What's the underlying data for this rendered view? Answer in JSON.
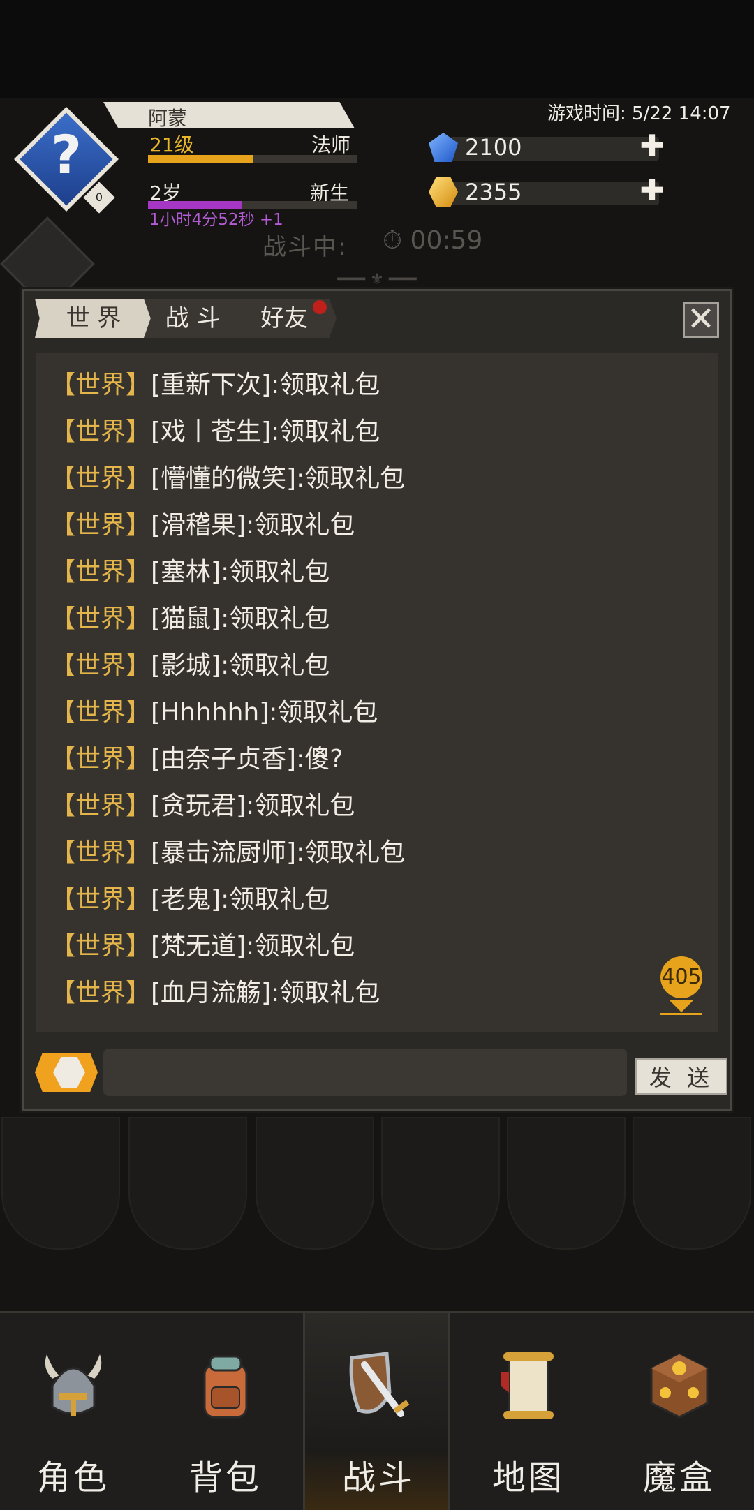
{
  "player": {
    "name": "阿蒙",
    "level": "21级",
    "class": "法师",
    "level_progress": 0.5,
    "age": "2岁",
    "stage": "新生",
    "age_progress": 0.45,
    "timer": "1小时4分52秒 +1",
    "avatar_glyph": "?",
    "avatar_badge": "0"
  },
  "game_time": "游戏时间: 5/22 14:07",
  "resources": [
    {
      "icon": "blue-gem-icon",
      "value": "2100",
      "color": "#3b7de0"
    },
    {
      "icon": "gold-gem-icon",
      "value": "2355",
      "color": "#e8a31c"
    }
  ],
  "battle": {
    "status_label": "战斗中:",
    "clock": "00:59"
  },
  "chat": {
    "tabs": [
      "世 界",
      "战 斗",
      "好友"
    ],
    "active_tab": 0,
    "channel_tag": "【世界】",
    "messages": [
      {
        "user": "[重新下次]",
        "text": ":领取礼包"
      },
      {
        "user": "[戏丨苍生]",
        "text": ":领取礼包"
      },
      {
        "user": "[懵懂的微笑]",
        "text": ":领取礼包"
      },
      {
        "user": "[滑稽果]",
        "text": ":领取礼包"
      },
      {
        "user": "[塞林]",
        "text": ":领取礼包"
      },
      {
        "user": "[猫鼠]",
        "text": ":领取礼包"
      },
      {
        "user": "[影城]",
        "text": ":领取礼包"
      },
      {
        "user": "[Hhhhhh]",
        "text": ":领取礼包"
      },
      {
        "user": "[由奈子贞香]",
        "text": ":傻?"
      },
      {
        "user": "[贪玩君]",
        "text": ":领取礼包"
      },
      {
        "user": "[暴击流厨师]",
        "text": ":领取礼包"
      },
      {
        "user": "[老鬼]",
        "text": ":领取礼包"
      },
      {
        "user": "[梵无道]",
        "text": ":领取礼包"
      },
      {
        "user": "[血月流觞]",
        "text": ":领取礼包"
      }
    ],
    "unread_count": "405",
    "input_value": "",
    "send_label": "发 送"
  },
  "nav": [
    {
      "label": "角色",
      "icon": "helmet-icon"
    },
    {
      "label": "背包",
      "icon": "backpack-icon"
    },
    {
      "label": "战斗",
      "icon": "shield-sword-icon"
    },
    {
      "label": "地图",
      "icon": "scroll-map-icon"
    },
    {
      "label": "魔盒",
      "icon": "magic-box-icon"
    }
  ],
  "nav_active": 2
}
